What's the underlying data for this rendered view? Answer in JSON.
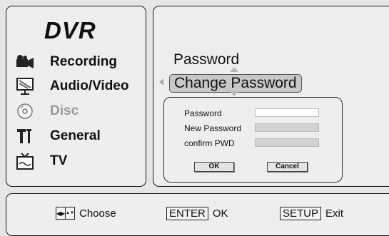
{
  "app": {
    "title": "DVR"
  },
  "menu": [
    {
      "label": "Recording",
      "icon": "camcorder-icon",
      "enabled": true
    },
    {
      "label": "Audio/Video",
      "icon": "monitor-icon",
      "enabled": true
    },
    {
      "label": "Disc",
      "icon": "disc-icon",
      "enabled": false
    },
    {
      "label": "General",
      "icon": "tools-icon",
      "enabled": true
    },
    {
      "label": "TV",
      "icon": "tv-icon",
      "enabled": true
    }
  ],
  "settings": {
    "header": "Password",
    "selected_option": "Change Password"
  },
  "dialog": {
    "fields": [
      {
        "label": "Password",
        "value": ""
      },
      {
        "label": "New Password",
        "value": ""
      },
      {
        "label": "confirm PWD",
        "value": ""
      }
    ],
    "ok_label": "OK",
    "cancel_label": "Cancel"
  },
  "footer": {
    "choose_label": "Choose",
    "enter_key": "ENTER",
    "enter_action": "OK",
    "setup_key": "SETUP",
    "setup_action": "Exit"
  }
}
